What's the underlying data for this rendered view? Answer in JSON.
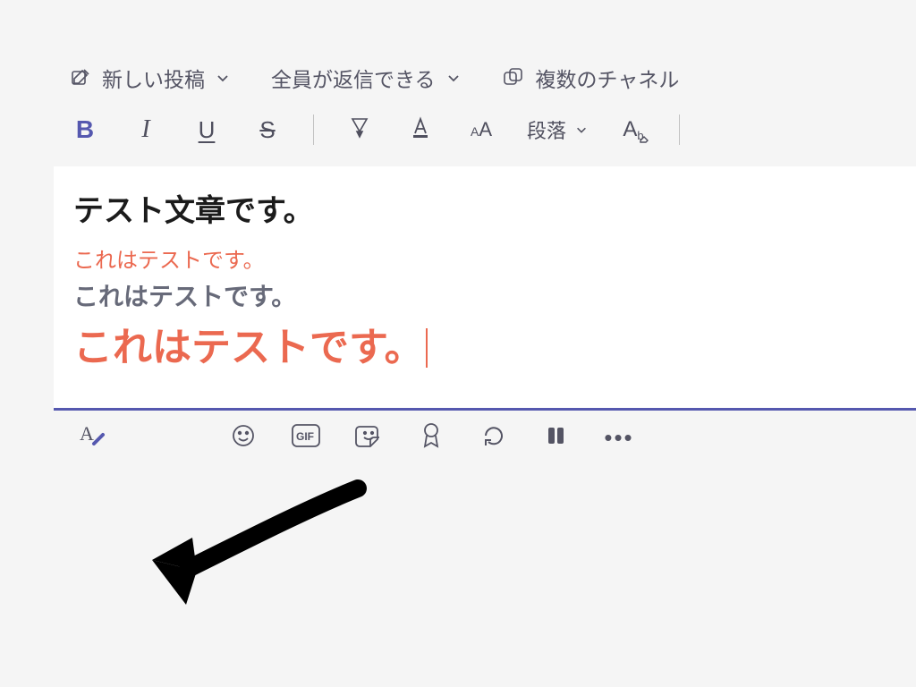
{
  "topbar": {
    "new_post_label": "新しい投稿",
    "reply_scope_label": "全員が返信できる",
    "multichannel_label": "複数のチャネル"
  },
  "formatbar": {
    "paragraph_label": "段落"
  },
  "editor": {
    "title": "テスト文章です。",
    "line_red": "これはテストです。",
    "line_grey": "これはテストです。",
    "line_big": "これはテストです。"
  },
  "icons": {
    "compose": "compose-icon",
    "chevron_down": "chevron-down-icon",
    "multichannel": "multichannel-icon",
    "bold": "bold-icon",
    "italic": "italic-icon",
    "underline": "underline-icon",
    "strike": "strikethrough-icon",
    "highlight": "highlight-icon",
    "fontcolor": "font-color-icon",
    "fontsize": "font-size-icon",
    "clearfmt": "clear-formatting-icon",
    "format": "format-icon",
    "emoji": "emoji-icon",
    "gif": "gif-icon",
    "sticker": "sticker-icon",
    "praise": "praise-icon",
    "loop": "loop-icon",
    "apps": "apps-icon",
    "more": "more-icon"
  },
  "colors": {
    "accent": "#5558af",
    "text_muted": "#545464",
    "text_red": "#eb6950"
  }
}
